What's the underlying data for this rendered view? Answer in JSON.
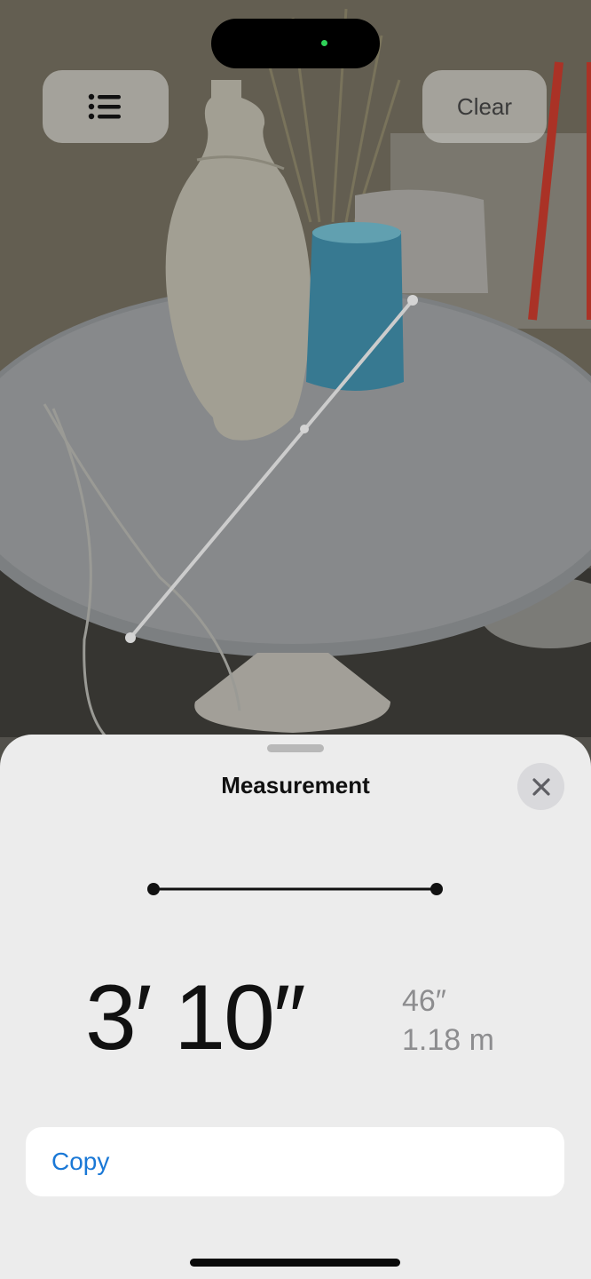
{
  "toolbar": {
    "list_icon": "list-bullet-icon",
    "clear_label": "Clear"
  },
  "sheet": {
    "title": "Measurement",
    "close_icon": "close-icon",
    "primary_value": "3′ 10″",
    "secondary_inches": "46″",
    "secondary_meters": "1.18 m",
    "copy_label": "Copy"
  },
  "colors": {
    "accent": "#1a78d6",
    "status_dot": "#2fd158",
    "sheet_background": "#ececec"
  }
}
